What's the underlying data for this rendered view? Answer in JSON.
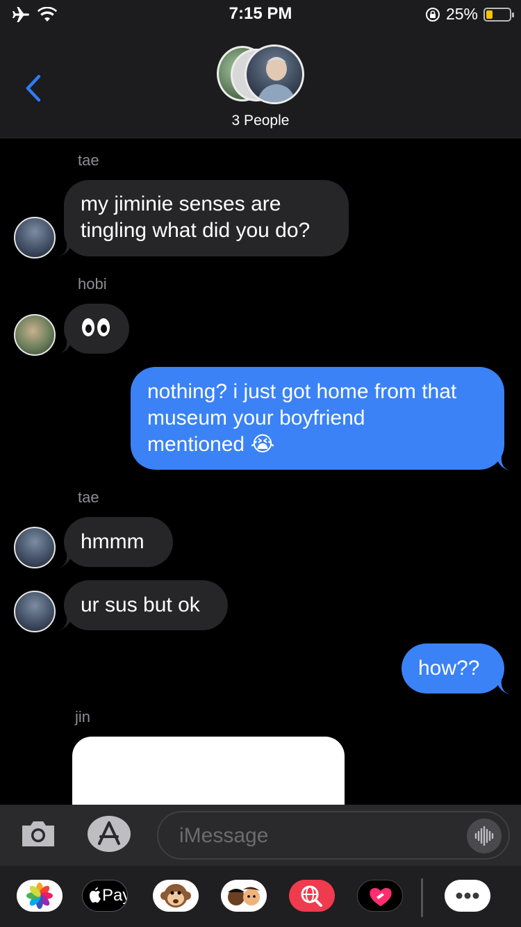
{
  "status_bar": {
    "time": "7:15 PM",
    "battery_percent": "25%",
    "battery_level": 0.25,
    "icons": [
      "airplane-icon",
      "wifi-icon",
      "rotation-lock-icon",
      "battery-icon"
    ]
  },
  "header": {
    "title": "3 People",
    "back_icon": "chevron-left-icon"
  },
  "messages": [
    {
      "sender": "tae",
      "text": "my jiminie senses are tingling what did you do?",
      "line1": "my jiminie senses are",
      "line2": "tingling what did you do?",
      "direction": "incoming"
    },
    {
      "sender": "hobi",
      "text": "👀",
      "direction": "incoming"
    },
    {
      "sender": "",
      "line1": "nothing? i just got home from that",
      "line2": "museum your boyfriend",
      "line3": "mentioned",
      "emoji": "😭",
      "direction": "outgoing"
    },
    {
      "sender": "tae",
      "text": "hmmm",
      "direction": "incoming"
    },
    {
      "sender": "",
      "text": "ur sus but ok",
      "direction": "incoming"
    },
    {
      "sender": "",
      "text": "how??",
      "direction": "outgoing"
    },
    {
      "sender": "jin",
      "text": "",
      "direction": "incoming"
    }
  ],
  "composer": {
    "placeholder": "iMessage",
    "camera_icon": "camera-icon",
    "apps_icon": "app-store-icon",
    "audio_icon": "audio-waveform-icon"
  },
  "app_strip": {
    "apple_pay_label": "Pay",
    "items": [
      "photos-icon",
      "apple-pay-icon",
      "monkey-animoji-icon",
      "memoji-icon",
      "search-images-icon",
      "heart-app-icon",
      "more-icon"
    ]
  },
  "colors": {
    "outgoing_bubble": "#3a82f6",
    "incoming_bubble": "#262628",
    "accent": "#2f7cf6",
    "battery": "#f5c400"
  }
}
